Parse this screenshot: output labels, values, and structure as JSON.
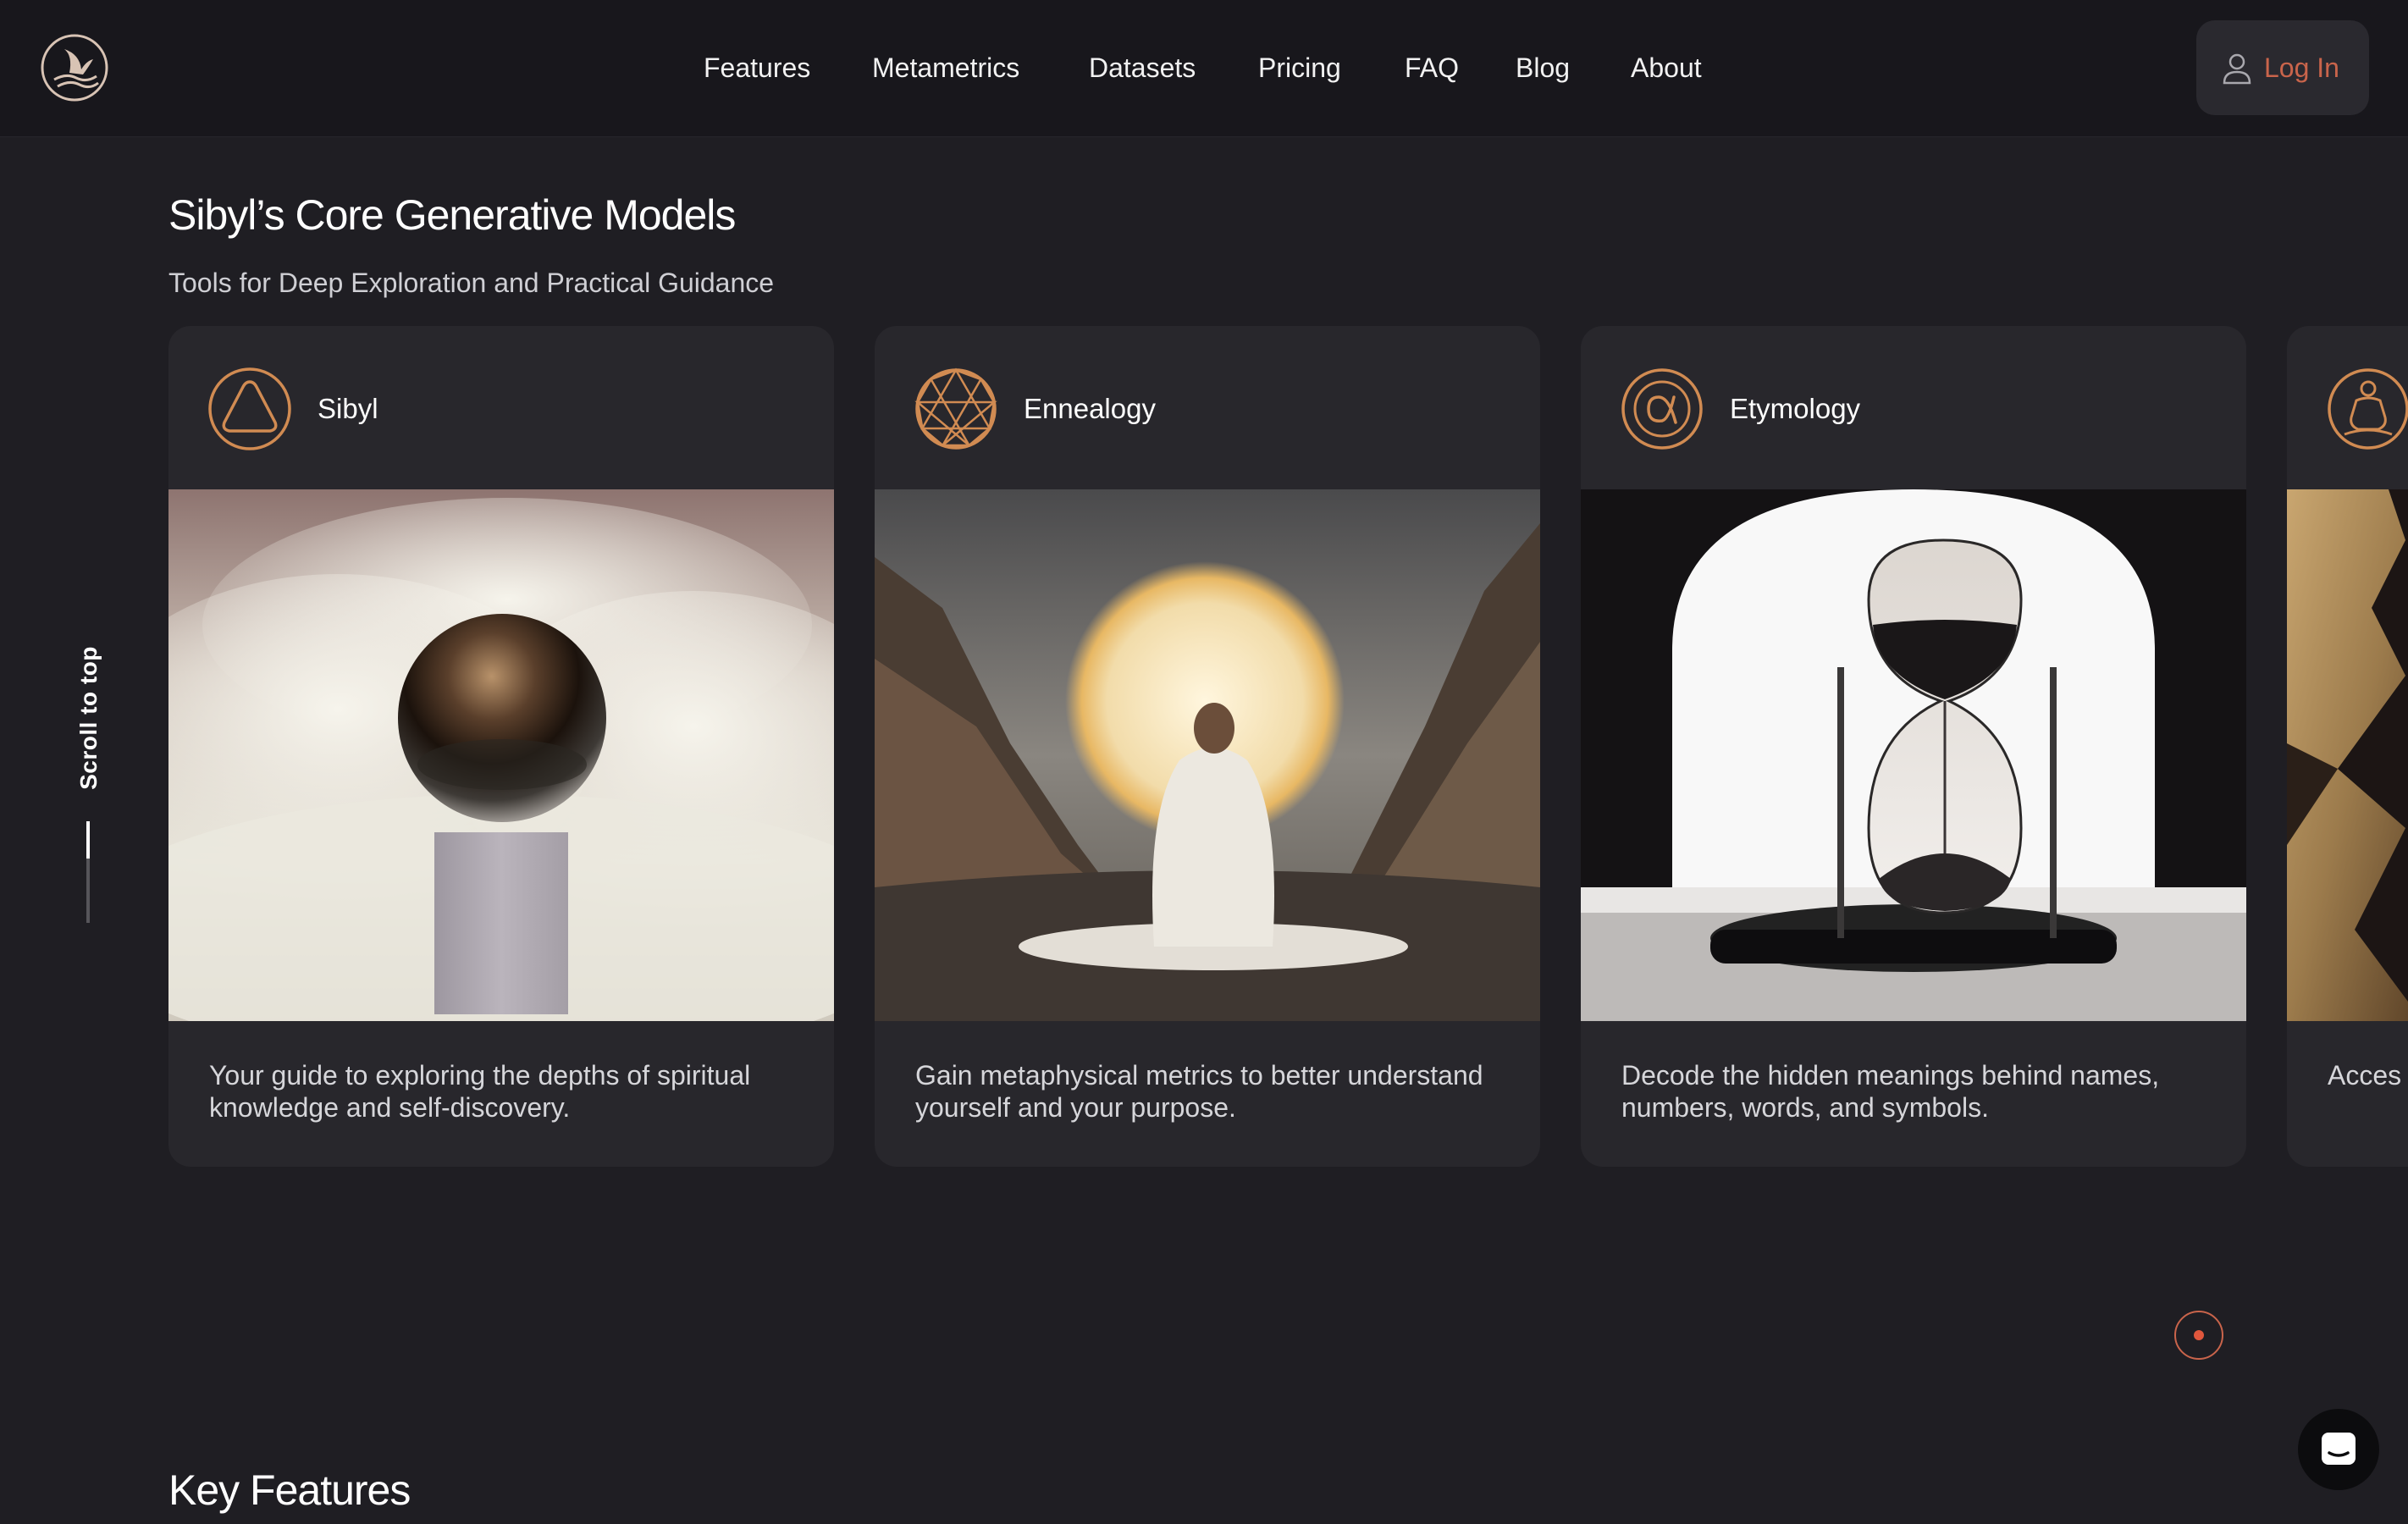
{
  "nav": {
    "logo": "sibyl-wave-logo",
    "links": [
      "Features",
      "Metametrics",
      "Datasets",
      "Pricing",
      "FAQ",
      "Blog",
      "About"
    ],
    "login_label": "Log In"
  },
  "section": {
    "title": "Sibyl’s Core Generative Models",
    "subtitle": "Tools for Deep Exploration and Practical Guidance"
  },
  "scroll_to_top": "Scroll to top",
  "cards": [
    {
      "name": "Sibyl",
      "icon": "rounded-triangle-icon",
      "image": "sphere-on-pedestal-in-clouds",
      "description": "Your guide to exploring the depths of spiritual knowledge and self-discovery."
    },
    {
      "name": "Ennealogy",
      "icon": "enneagram-icon",
      "image": "robed-figure-before-glowing-halo",
      "description": "Gain metaphysical metrics to better understand yourself and your purpose."
    },
    {
      "name": "Etymology",
      "icon": "alpha-icon",
      "image": "hourglass-in-arch",
      "description": "Decode the hidden meanings behind names, numbers, words, and symbols."
    },
    {
      "name": "",
      "icon": "meditating-figure-icon",
      "image": "golden-geometric-shape",
      "description": "Acces system"
    }
  ],
  "carousel_page_indicator": "1",
  "next_section_title": "Key Features",
  "colors": {
    "accent": "#c9644b",
    "icon_gold": "#d18b52",
    "background": "#1f1e23",
    "navbar": "#18171c",
    "card": "#28272c"
  }
}
